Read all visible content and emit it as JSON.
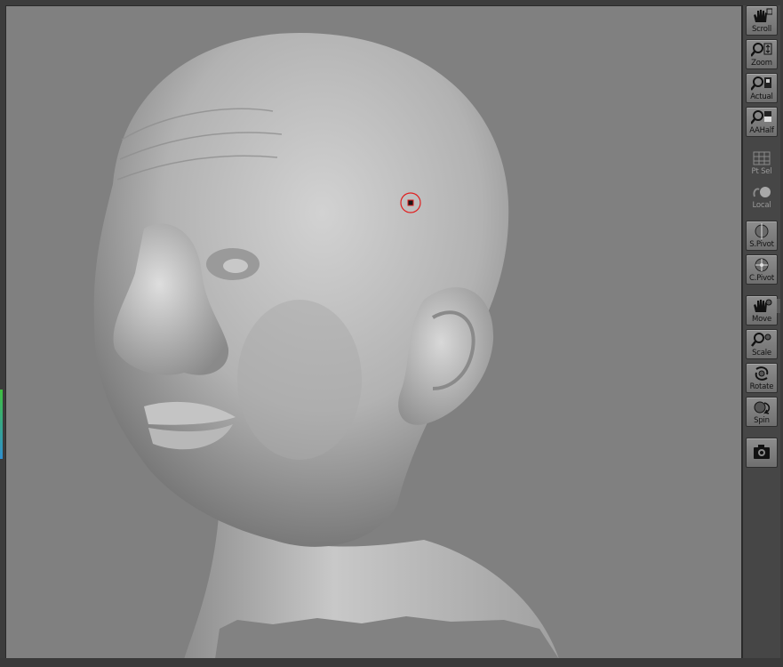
{
  "toolbar": {
    "buttons": [
      {
        "id": "scroll",
        "label": "Scroll",
        "icon": "hand-scroll-icon"
      },
      {
        "id": "zoom",
        "label": "Zoom",
        "icon": "magnifier-zoom-icon"
      },
      {
        "id": "actual",
        "label": "Actual",
        "icon": "magnifier-actual-icon"
      },
      {
        "id": "aahalf",
        "label": "AAHalf",
        "icon": "magnifier-aahalf-icon"
      },
      {
        "id": "ptsel",
        "label": "Pt Sel",
        "icon": "grid-icon"
      },
      {
        "id": "local",
        "label": "Local",
        "icon": "local-sphere-icon"
      },
      {
        "id": "spivot",
        "label": "S.Pivot",
        "icon": "sphere-pivot-icon"
      },
      {
        "id": "cpivot",
        "label": "C.Pivot",
        "icon": "center-pivot-icon"
      },
      {
        "id": "move",
        "label": "Move",
        "icon": "hand-move-icon"
      },
      {
        "id": "scale",
        "label": "Scale",
        "icon": "magnifier-scale-icon"
      },
      {
        "id": "rotate",
        "label": "Rotate",
        "icon": "rotate-icon"
      },
      {
        "id": "spin",
        "label": "Spin",
        "icon": "spin-icon"
      },
      {
        "id": "snapshot",
        "label": "",
        "icon": "camera-icon"
      }
    ]
  },
  "colors": {
    "canvas": "#808080",
    "panel": "#464646",
    "cursor_ring": "#e02020"
  }
}
